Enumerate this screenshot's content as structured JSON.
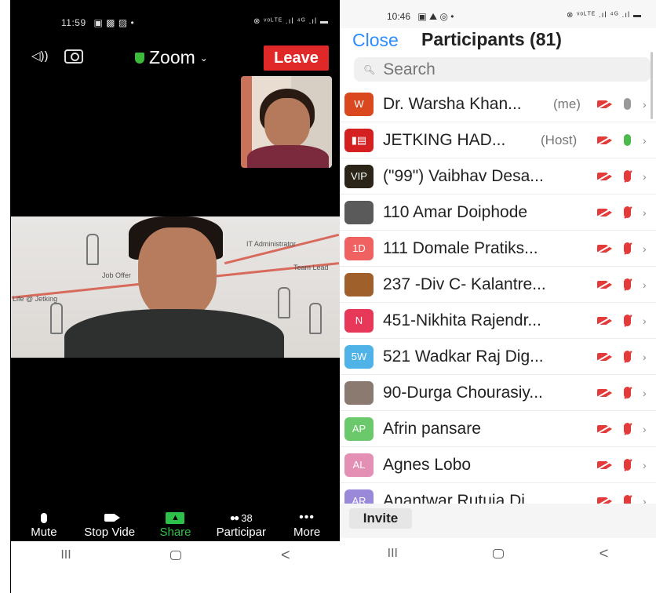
{
  "meeting": {
    "status_time": "11:59",
    "status_left_icons": "▣ ▩ ▨ •",
    "status_right": "⊗ ᵛᵒᴸᵀᴱ .ıl ⁴ᴳ .ıl ▬",
    "app_title": "Zoom",
    "leave_label": "Leave",
    "toolbar": [
      {
        "label": "Mute"
      },
      {
        "label": "Stop Vide"
      },
      {
        "label": "Share"
      },
      {
        "label": "Participar",
        "count": "38"
      },
      {
        "label": "More"
      }
    ],
    "nav": {
      "recents": "III",
      "back": "<"
    }
  },
  "panel": {
    "status_time": "10:46",
    "status_left_icons": "▣ ⛰ ◎ •",
    "status_right": "⊗ ᵛᵒᴸᵀᴱ .ıl ⁴ᴳ .ıl ▬",
    "close_label": "Close",
    "title": "Participants (81)",
    "search": {
      "placeholder": "Search",
      "value": ""
    },
    "participants": [
      {
        "initials": "W",
        "color": "#d9481e",
        "name": "Dr. Warsha Khan...",
        "tag": "(me)",
        "mic": "grey"
      },
      {
        "initials": "▮▤",
        "color": "#d42020",
        "name": "JETKING HAD...",
        "tag": "(Host)",
        "mic": "green"
      },
      {
        "initials": "VIP",
        "color": "#2b2418",
        "name": "(\"99\") Vaibhav Desa...",
        "tag": "",
        "mic": "muted"
      },
      {
        "initials": "",
        "color": "#5a5a5a",
        "name": "110 Amar Doiphode",
        "tag": "",
        "mic": "muted"
      },
      {
        "initials": "1D",
        "color": "#f06262",
        "name": "111 Domale Pratiks...",
        "tag": "",
        "mic": "muted"
      },
      {
        "initials": "",
        "color": "#a0602c",
        "name": "237 -Div C- Kalantre...",
        "tag": "",
        "mic": "muted"
      },
      {
        "initials": "N",
        "color": "#e8385a",
        "name": "451-Nikhita Rajendr...",
        "tag": "",
        "mic": "muted"
      },
      {
        "initials": "5W",
        "color": "#4fb3e8",
        "name": "521 Wadkar Raj Dig...",
        "tag": "",
        "mic": "muted"
      },
      {
        "initials": "",
        "color": "#8a7a70",
        "name": "90-Durga Chourasiy...",
        "tag": "",
        "mic": "muted"
      },
      {
        "initials": "AP",
        "color": "#6bc86b",
        "name": "Afrin pansare",
        "tag": "",
        "mic": "muted"
      },
      {
        "initials": "AL",
        "color": "#e48fb4",
        "name": "Agnes Lobo",
        "tag": "",
        "mic": "muted"
      },
      {
        "initials": "AR",
        "color": "#9a88d8",
        "name": "Anantwar Rutuja Di...",
        "tag": "",
        "mic": "muted"
      }
    ],
    "invite_label": "Invite",
    "nav": {
      "recents": "III",
      "back": "<"
    }
  }
}
